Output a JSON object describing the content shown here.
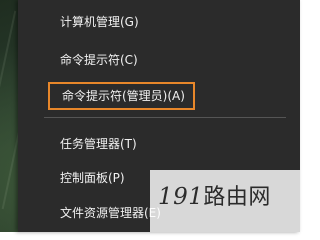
{
  "context_menu": {
    "items": [
      {
        "label": "计算机管理(G)"
      },
      {
        "label": "命令提示符(C)"
      },
      {
        "label": "命令提示符(管理员)(A)",
        "highlighted": true
      },
      {
        "label": "任务管理器(T)"
      },
      {
        "label": "控制面板(P)"
      },
      {
        "label": "文件资源管理器(E)"
      }
    ],
    "highlight_color": "#e8872a"
  },
  "watermark": {
    "digits": "191",
    "text": "路由网"
  }
}
